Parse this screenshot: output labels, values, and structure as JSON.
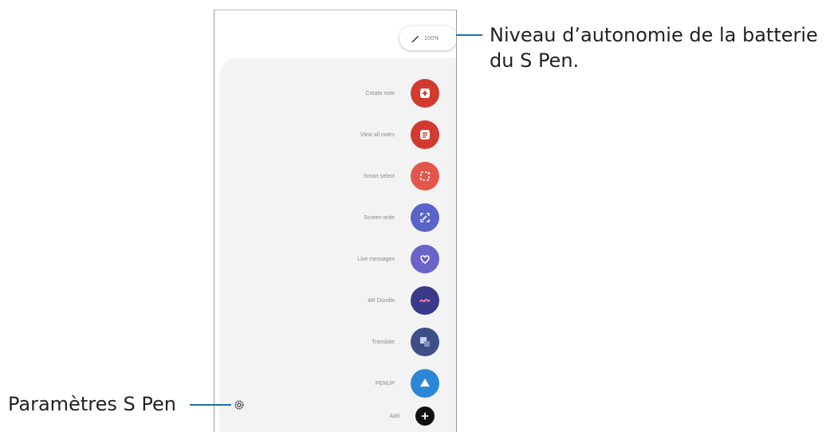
{
  "battery": {
    "level_text": "100%"
  },
  "menu_items": [
    {
      "label": "Create note",
      "icon": "create-note-icon",
      "color": "#d23a2f"
    },
    {
      "label": "View all notes",
      "icon": "view-all-notes-icon",
      "color": "#d23a2f"
    },
    {
      "label": "Smart select",
      "icon": "smart-select-icon",
      "color": "#e4554b"
    },
    {
      "label": "Screen write",
      "icon": "screen-write-icon",
      "color": "#5a64c8"
    },
    {
      "label": "Live messages",
      "icon": "live-messages-icon",
      "color": "#6a64c8"
    },
    {
      "label": "AR Doodle",
      "icon": "ar-doodle-icon",
      "color": "#3a3a8a"
    },
    {
      "label": "Translate",
      "icon": "translate-icon",
      "color": "#3d4f86"
    },
    {
      "label": "PENUP",
      "icon": "penup-icon",
      "color": "#2b86d8"
    },
    {
      "label": "Add",
      "icon": "add-icon",
      "color": "#111111"
    }
  ],
  "callouts": {
    "battery_line1": "Niveau d’autonomie de la batterie",
    "battery_line2": "du S Pen.",
    "settings": "Paramètres S Pen"
  }
}
